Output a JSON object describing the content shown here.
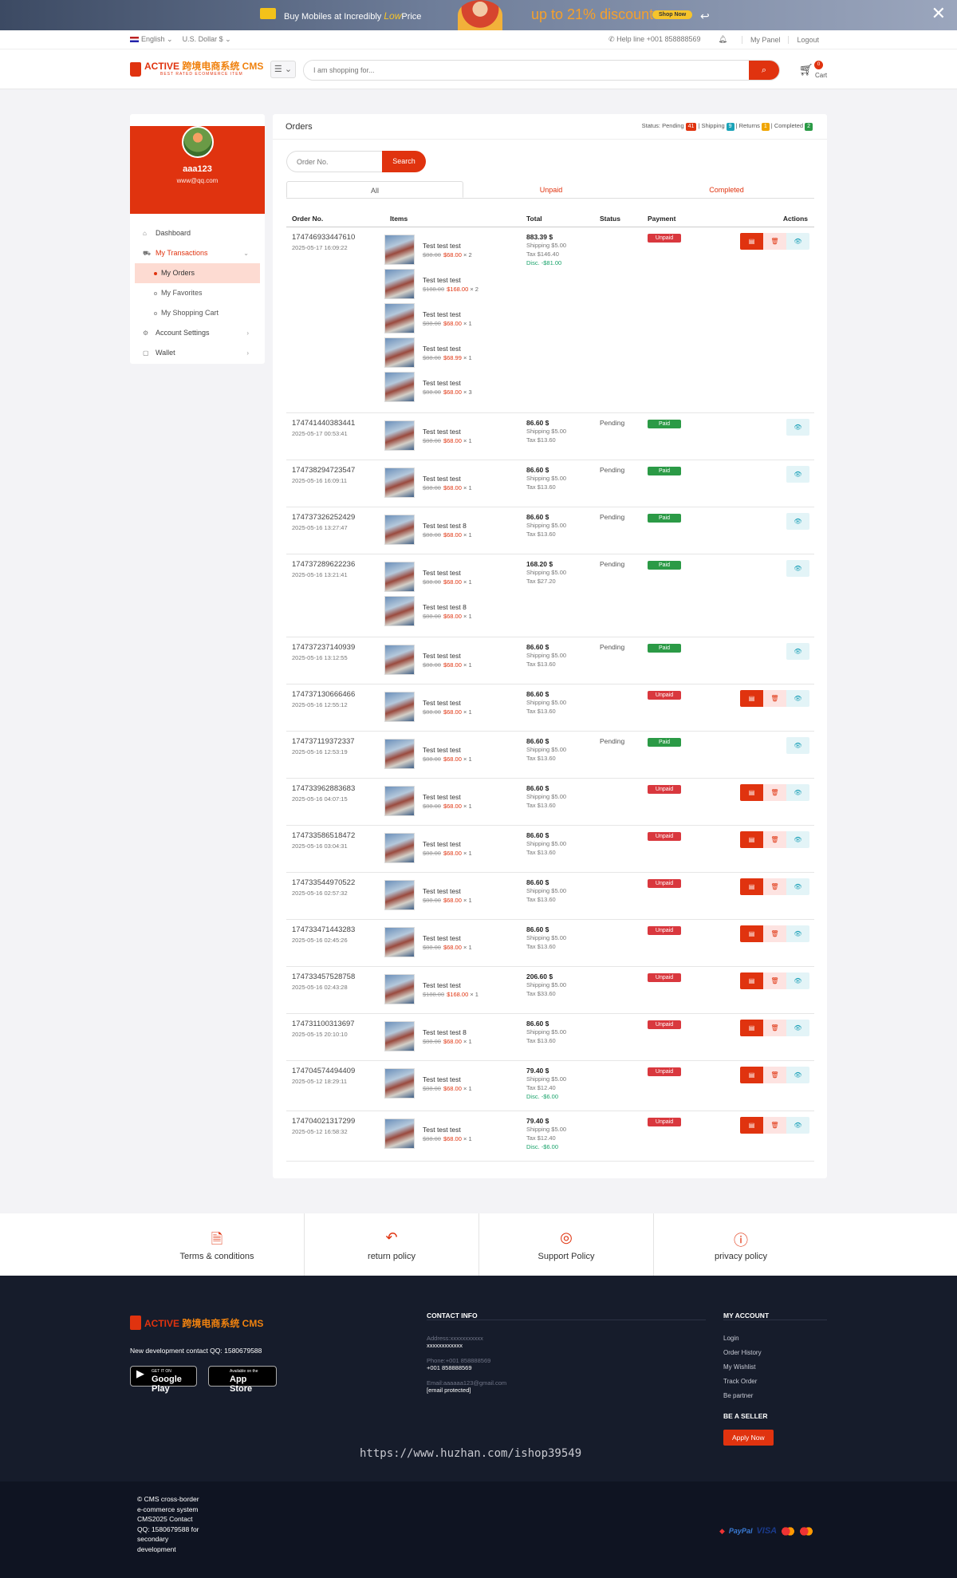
{
  "banner": {
    "text_before": "Buy Mobiles at Incredibly ",
    "text_low": "Low",
    "text_after": "Price",
    "discount": "up to 21% discount",
    "shop_label": "Shop Now",
    "close_icon": "close-icon"
  },
  "topbar": {
    "language": "English ⌄",
    "currency": "U.S. Dollar $ ⌄",
    "helpline": "✆ Help line +001 858888569",
    "my_panel": "My Panel",
    "logout": "Logout"
  },
  "header": {
    "logo_text": "ACTIVE ",
    "logo_cn": "跨境电商系统 CMS",
    "logo_sub": "BEST RATED ECOMMERCE ITEM",
    "menu_icon": "☰ ⌄",
    "search_placeholder": "I am shopping for...",
    "cart_count": "0",
    "cart_label": "Cart"
  },
  "sidebar": {
    "username": "aaa123",
    "email": "www@qq.com",
    "items": [
      {
        "label": "Dashboard",
        "icon": "⌂"
      },
      {
        "label": "My Transactions",
        "icon": "⛟",
        "chev": "⌄"
      },
      {
        "label": "Account Settings",
        "icon": "⚙",
        "chev": "›"
      },
      {
        "label": "Wallet",
        "icon": "▢",
        "chev": "›"
      }
    ],
    "subitems": [
      "My Orders",
      "My Favorites",
      "My Shopping Cart"
    ]
  },
  "orders": {
    "title": "Orders",
    "status": {
      "prefix": "Status: Pending",
      "pending": "41",
      "shipping_label": "| Shipping",
      "shipping": "9",
      "returns_label": "| Returns",
      "returns": "1",
      "completed_label": "| Completed",
      "completed": "2"
    },
    "search_placeholder": "Order No.",
    "search_button": "Search",
    "tabs": [
      "All",
      "Unpaid",
      "Completed"
    ],
    "columns": [
      "Order No.",
      "Items",
      "Total",
      "Status",
      "Payment",
      "Actions"
    ],
    "rows": [
      {
        "id": "174746933447610",
        "date": "2025-05-17 16:09:22",
        "total": "883.39 $",
        "shipping": "Shipping $5.00",
        "tax": "Tax $146.40",
        "disc": "Disc. -$81.00",
        "status": "",
        "payment": "Unpaid",
        "items": [
          {
            "name": "Test test test",
            "old": "$88.00",
            "price": "$68.00",
            "qty": "× 2"
          },
          {
            "name": "Test test test",
            "old": "$188.00",
            "price": "$168.00",
            "qty": "× 2"
          },
          {
            "name": "Test test test",
            "old": "$88.00",
            "price": "$68.00",
            "qty": "× 1"
          },
          {
            "name": "Test test test",
            "old": "$88.00",
            "price": "$68.99",
            "qty": "× 1"
          },
          {
            "name": "Test test test",
            "old": "$88.00",
            "price": "$68.00",
            "qty": "× 3"
          }
        ]
      },
      {
        "id": "174741440383441",
        "date": "2025-05-17 00:53:41",
        "total": "86.60 $",
        "shipping": "Shipping $5.00",
        "tax": "Tax $13.60",
        "disc": "",
        "status": "Pending",
        "payment": "Paid",
        "items": [
          {
            "name": "Test test test",
            "old": "$88.00",
            "price": "$68.00",
            "qty": "× 1"
          }
        ]
      },
      {
        "id": "174738294723547",
        "date": "2025-05-16 16:09:11",
        "total": "86.60 $",
        "shipping": "Shipping $5.00",
        "tax": "Tax $13.60",
        "disc": "",
        "status": "Pending",
        "payment": "Paid",
        "items": [
          {
            "name": "Test test test",
            "old": "$88.00",
            "price": "$68.00",
            "qty": "× 1"
          }
        ]
      },
      {
        "id": "174737326252429",
        "date": "2025-05-16 13:27:47",
        "total": "86.60 $",
        "shipping": "Shipping $5.00",
        "tax": "Tax $13.60",
        "disc": "",
        "status": "Pending",
        "payment": "Paid",
        "items": [
          {
            "name": "Test test test 8",
            "old": "$88.00",
            "price": "$68.00",
            "qty": "× 1"
          }
        ]
      },
      {
        "id": "174737289622236",
        "date": "2025-05-16 13:21:41",
        "total": "168.20 $",
        "shipping": "Shipping $5.00",
        "tax": "Tax $27.20",
        "disc": "",
        "status": "Pending",
        "payment": "Paid",
        "items": [
          {
            "name": "Test test test",
            "old": "$88.00",
            "price": "$68.00",
            "qty": "× 1"
          },
          {
            "name": "Test test test 8",
            "old": "$88.00",
            "price": "$68.00",
            "qty": "× 1"
          }
        ]
      },
      {
        "id": "174737237140939",
        "date": "2025-05-16 13:12:55",
        "total": "86.60 $",
        "shipping": "Shipping $5.00",
        "tax": "Tax $13.60",
        "disc": "",
        "status": "Pending",
        "payment": "Paid",
        "items": [
          {
            "name": "Test test test",
            "old": "$88.00",
            "price": "$68.00",
            "qty": "× 1"
          }
        ]
      },
      {
        "id": "174737130666466",
        "date": "2025-05-16 12:55:12",
        "total": "86.60 $",
        "shipping": "Shipping $5.00",
        "tax": "Tax $13.60",
        "disc": "",
        "status": "",
        "payment": "Unpaid",
        "items": [
          {
            "name": "Test test test",
            "old": "$88.00",
            "price": "$68.00",
            "qty": "× 1"
          }
        ]
      },
      {
        "id": "174737119372337",
        "date": "2025-05-16 12:53:19",
        "total": "86.60 $",
        "shipping": "Shipping $5.00",
        "tax": "Tax $13.60",
        "disc": "",
        "status": "Pending",
        "payment": "Paid",
        "items": [
          {
            "name": "Test test test",
            "old": "$88.00",
            "price": "$68.00",
            "qty": "× 1"
          }
        ]
      },
      {
        "id": "174733962883683",
        "date": "2025-05-16 04:07:15",
        "total": "86.60 $",
        "shipping": "Shipping $5.00",
        "tax": "Tax $13.60",
        "disc": "",
        "status": "",
        "payment": "Unpaid",
        "items": [
          {
            "name": "Test test test",
            "old": "$88.00",
            "price": "$68.00",
            "qty": "× 1"
          }
        ]
      },
      {
        "id": "174733586518472",
        "date": "2025-05-16 03:04:31",
        "total": "86.60 $",
        "shipping": "Shipping $5.00",
        "tax": "Tax $13.60",
        "disc": "",
        "status": "",
        "payment": "Unpaid",
        "items": [
          {
            "name": "Test test test",
            "old": "$88.00",
            "price": "$68.00",
            "qty": "× 1"
          }
        ]
      },
      {
        "id": "174733544970522",
        "date": "2025-05-16 02:57:32",
        "total": "86.60 $",
        "shipping": "Shipping $5.00",
        "tax": "Tax $13.60",
        "disc": "",
        "status": "",
        "payment": "Unpaid",
        "items": [
          {
            "name": "Test test test",
            "old": "$88.00",
            "price": "$68.00",
            "qty": "× 1"
          }
        ]
      },
      {
        "id": "174733471443283",
        "date": "2025-05-16 02:45:26",
        "total": "86.60 $",
        "shipping": "Shipping $5.00",
        "tax": "Tax $13.60",
        "disc": "",
        "status": "",
        "payment": "Unpaid",
        "items": [
          {
            "name": "Test test test",
            "old": "$88.00",
            "price": "$68.00",
            "qty": "× 1"
          }
        ]
      },
      {
        "id": "174733457528758",
        "date": "2025-05-16 02:43:28",
        "total": "206.60 $",
        "shipping": "Shipping $5.00",
        "tax": "Tax $33.60",
        "disc": "",
        "status": "",
        "payment": "Unpaid",
        "items": [
          {
            "name": "Test test test",
            "old": "$188.00",
            "price": "$168.00",
            "qty": "× 1"
          }
        ]
      },
      {
        "id": "174731100313697",
        "date": "2025-05-15 20:10:10",
        "total": "86.60 $",
        "shipping": "Shipping $5.00",
        "tax": "Tax $13.60",
        "disc": "",
        "status": "",
        "payment": "Unpaid",
        "items": [
          {
            "name": "Test test test 8",
            "old": "$88.00",
            "price": "$68.00",
            "qty": "× 1"
          }
        ]
      },
      {
        "id": "174704574494409",
        "date": "2025-05-12 18:29:11",
        "total": "79.40 $",
        "shipping": "Shipping $5.00",
        "tax": "Tax $12.40",
        "disc": "Disc. -$6.00",
        "status": "",
        "payment": "Unpaid",
        "items": [
          {
            "name": "Test test test",
            "old": "$88.00",
            "price": "$68.00",
            "qty": "× 1"
          }
        ]
      },
      {
        "id": "174704021317299",
        "date": "2025-05-12 16:58:32",
        "total": "79.40 $",
        "shipping": "Shipping $5.00",
        "tax": "Tax $12.40",
        "disc": "Disc. -$6.00",
        "status": "",
        "payment": "Unpaid",
        "items": [
          {
            "name": "Test test test",
            "old": "$88.00",
            "price": "$68.00",
            "qty": "× 1"
          }
        ]
      }
    ]
  },
  "policies": [
    {
      "label": "Terms & conditions",
      "icon": "🗎"
    },
    {
      "label": "return policy",
      "icon": "↶"
    },
    {
      "label": "Support Policy",
      "icon": "◎"
    },
    {
      "label": "privacy policy",
      "icon": "ⓘ"
    }
  ],
  "footer": {
    "logo_text": "ACTIVE ",
    "logo_cn": "跨境电商系统 CMS",
    "contact_qq": "New development contact QQ: 1580679588",
    "google_small": "GET IT ON",
    "google_big": "Google Play",
    "apple_small": "Available on the",
    "apple_big": "App Store",
    "contact_title": "CONTACT INFO",
    "address_label": "Address:xxxxxxxxxxx",
    "address_val": "xxxxxxxxxxxx",
    "phone_label": "Phone:+001 858888569",
    "phone_val": "+001 858888569",
    "email_label": "Email:aaaaaa123@gmail.com",
    "email_val": "[email protected]",
    "account_title": "MY ACCOUNT",
    "account_links": [
      "Login",
      "Order History",
      "My Wishlist",
      "Track Order",
      "Be partner"
    ],
    "seller_title": "BE A SELLER",
    "apply": "Apply Now",
    "watermark": "https://www.huzhan.com/ishop39549"
  },
  "bottom": {
    "copyright": "© CMS cross-border e-commerce system CMS2025 Contact QQ: 1580679588 for secondary development",
    "paypal": "PayPal",
    "visa": "VISA"
  }
}
